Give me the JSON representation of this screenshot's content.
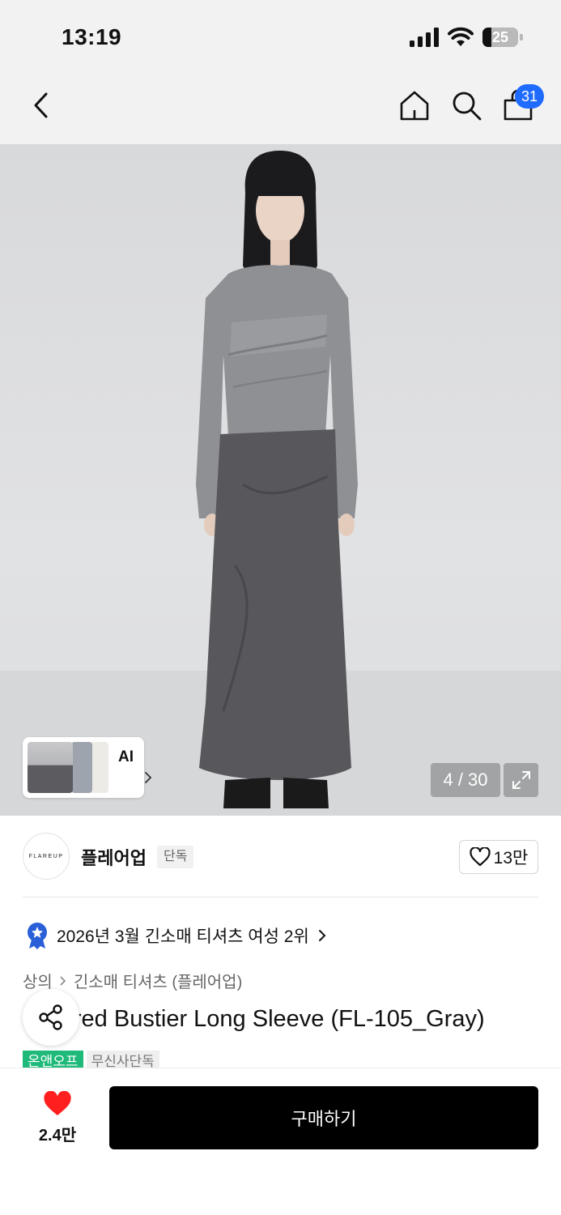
{
  "status_bar": {
    "time": "13:19",
    "battery_level": "25",
    "battery_fraction": 0.25
  },
  "header": {
    "icons": [
      "chevron-left-icon",
      "home-icon",
      "search-icon",
      "shopping-bag-icon"
    ],
    "cart_count": "31",
    "badge_color": "#1f6bff"
  },
  "gallery": {
    "ai_label": "AI",
    "counter": "4 / 30"
  },
  "brand": {
    "logo_text": "FLAREUP",
    "name": "플레어업",
    "tag": "단독",
    "like_count": "13만"
  },
  "ranking": {
    "text": "2026년 3월 긴소매 티셔츠 여성 2위"
  },
  "breadcrumb": {
    "category": "상의",
    "subcategory": "긴소매 티셔츠 (플레어업)"
  },
  "product": {
    "title": "Layered Bustier Long Sleeve (FL-105_Gray)",
    "tags": [
      "온앤오프",
      "무신사단독"
    ]
  },
  "bottom_bar": {
    "wish_count": "2.4만",
    "buy_label": "구매하기",
    "heart_color": "#ff1f1f"
  }
}
